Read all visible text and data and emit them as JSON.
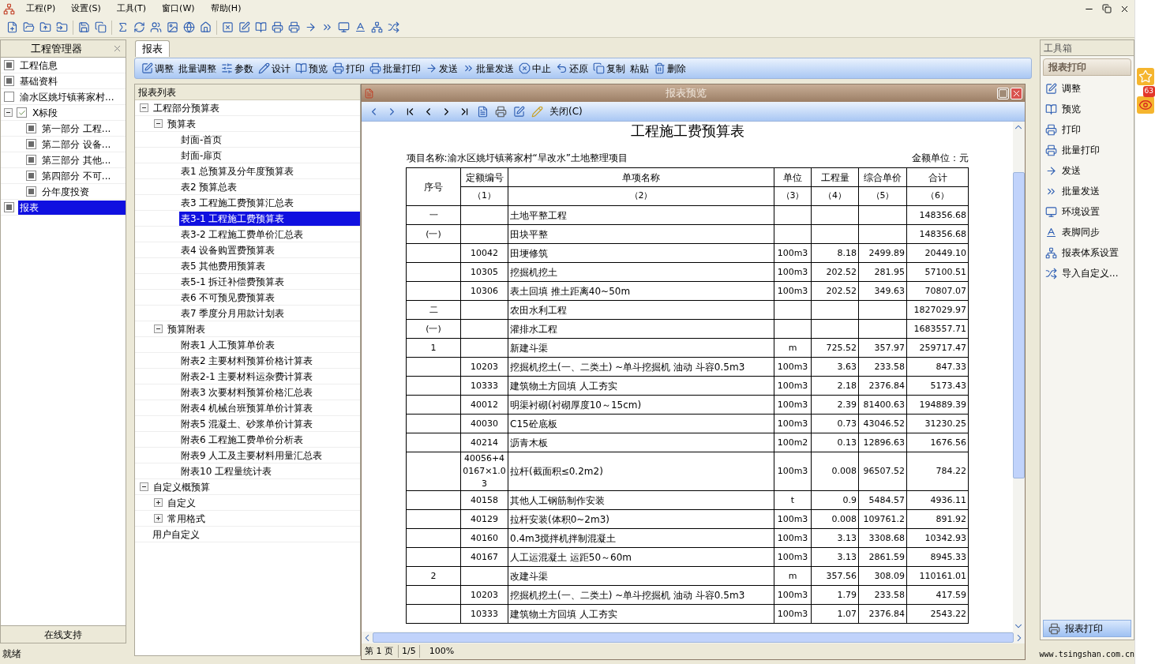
{
  "menu": [
    "工程(P)",
    "设置(S)",
    "工具(T)",
    "窗口(W)",
    "帮助(H)"
  ],
  "project_manager": {
    "title": "工程管理器",
    "items": [
      {
        "label": "工程信息",
        "checked": false,
        "indeterminate": true,
        "selected": false
      },
      {
        "label": "基础资料",
        "checked": false,
        "indeterminate": true,
        "selected": false
      },
      {
        "label": "渝水区姚圩镇蒋家村...",
        "checked": false,
        "indeterminate": false,
        "selected": false
      },
      {
        "label": "X标段",
        "checked": true,
        "indeterminate": false,
        "selected": false,
        "expanded": true,
        "children": [
          {
            "label": "第一部分 工程...",
            "checked": false,
            "indeterminate": true,
            "selected": false
          },
          {
            "label": "第二部分 设备...",
            "checked": false,
            "indeterminate": true,
            "selected": false
          },
          {
            "label": "第三部分 其他...",
            "checked": false,
            "indeterminate": true,
            "selected": false
          },
          {
            "label": "第四部分 不可...",
            "checked": false,
            "indeterminate": true,
            "selected": false
          },
          {
            "label": "分年度投资",
            "checked": false,
            "indeterminate": true,
            "selected": false
          }
        ]
      },
      {
        "label": "报表",
        "checked": false,
        "indeterminate": true,
        "selected": true
      }
    ],
    "footer": "在线支持"
  },
  "tabs": [
    {
      "label": "报表",
      "selected": true
    }
  ],
  "report_toolbar": [
    "调整",
    "批量调整",
    "参数",
    "设计",
    "预览",
    "打印",
    "批量打印",
    "发送",
    "批量发送",
    "中止",
    "还原",
    "复制",
    "粘贴",
    "删除"
  ],
  "report_list": {
    "title": "报表列表",
    "items": [
      {
        "label": "工程部分预算表",
        "selected": false,
        "expanded": true,
        "children": [
          {
            "label": "预算表",
            "selected": false,
            "expanded": true,
            "children": [
              {
                "label": "封面-首页",
                "selected": false
              },
              {
                "label": "封面-扉页",
                "selected": false
              },
              {
                "label": "表1 总预算及分年度预算表",
                "selected": false
              },
              {
                "label": "表2 预算总表",
                "selected": false
              },
              {
                "label": "表3 工程施工费预算汇总表",
                "selected": false
              },
              {
                "label": "表3-1 工程施工费预算表",
                "selected": true
              },
              {
                "label": "表3-2 工程施工费单价汇总表",
                "selected": false
              },
              {
                "label": "表4 设备购置费预算表",
                "selected": false
              },
              {
                "label": "表5 其他费用预算表",
                "selected": false
              },
              {
                "label": "表5-1 拆迁补偿费预算表",
                "selected": false
              },
              {
                "label": "表6 不可预见费预算表",
                "selected": false
              },
              {
                "label": "表7 季度分月用款计划表",
                "selected": false
              }
            ]
          },
          {
            "label": "预算附表",
            "selected": false,
            "expanded": true,
            "children": [
              {
                "label": "附表1 人工预算单价表",
                "selected": false
              },
              {
                "label": "附表2 主要材料预算价格计算表",
                "selected": false
              },
              {
                "label": "附表2-1 主要材料运杂费计算表",
                "selected": false
              },
              {
                "label": "附表3 次要材料预算价格汇总表",
                "selected": false
              },
              {
                "label": "附表4 机械台班预算单价计算表",
                "selected": false
              },
              {
                "label": "附表5 混凝土、砂浆单价计算表",
                "selected": false
              },
              {
                "label": "附表6 工程施工费单价分析表",
                "selected": false
              },
              {
                "label": "附表9 人工及主要材料用量汇总表",
                "selected": false
              },
              {
                "label": "附表10 工程量统计表",
                "selected": false
              }
            ]
          }
        ]
      },
      {
        "label": "自定义概预算",
        "selected": false,
        "expanded": true,
        "children": [
          {
            "label": "自定义",
            "selected": false,
            "expanded": false
          },
          {
            "label": "常用格式",
            "selected": false,
            "expanded": false
          }
        ]
      },
      {
        "label": "用户自定义",
        "selected": false
      }
    ]
  },
  "preview": {
    "title": "报表预览",
    "close_label": "关闭(C)",
    "report": {
      "title": "工程施工费预算表",
      "project": "项目名称:渝水区姚圩镇蒋家村“旱改水”土地整理项目",
      "unit_note": "金额单位：元",
      "columns": [
        {
          "label": "序号"
        },
        {
          "label": "定额编号",
          "index": "（1）"
        },
        {
          "label": "单项名称",
          "index": "（2）"
        },
        {
          "label": "单位",
          "index": "（3）"
        },
        {
          "label": "工程量",
          "index": "（4）"
        },
        {
          "label": "综合单价",
          "index": "（5）"
        },
        {
          "label": "合计",
          "index": "（6）"
        }
      ],
      "rows": [
        {
          "seq": "一",
          "name": "土地平整工程",
          "total": "148356.68"
        },
        {
          "seq": "(一)",
          "name": "田块平整",
          "total": "148356.68"
        },
        {
          "code": "10042",
          "name": "田埂修筑",
          "unit": "100m3",
          "qty": "8.18",
          "price": "2499.89",
          "total": "20449.10"
        },
        {
          "code": "10305",
          "name": "挖掘机挖土",
          "unit": "100m3",
          "qty": "202.52",
          "price": "281.95",
          "total": "57100.51"
        },
        {
          "code": "10306",
          "name": "表土回填  推土距离40~50m",
          "unit": "100m3",
          "qty": "202.52",
          "price": "349.63",
          "total": "70807.07"
        },
        {
          "seq": "二",
          "name": "农田水利工程",
          "total": "1827029.97"
        },
        {
          "seq": "(一)",
          "name": "灌排水工程",
          "total": "1683557.71"
        },
        {
          "seq": "1",
          "name": "新建斗渠",
          "unit": "m",
          "qty": "725.52",
          "price": "357.97",
          "total": "259717.47"
        },
        {
          "code": "10203",
          "name": "挖掘机挖土(一、二类土) ~单斗挖掘机  油动  斗容0.5m3",
          "unit": "100m3",
          "qty": "3.63",
          "price": "233.58",
          "total": "847.33"
        },
        {
          "code": "10333",
          "name": "建筑物土方回填 人工夯实",
          "unit": "100m3",
          "qty": "2.18",
          "price": "2376.84",
          "total": "5173.43"
        },
        {
          "code": "40012",
          "name": "明渠衬砌(衬砌厚度10～15cm)",
          "unit": "100m3",
          "qty": "2.39",
          "price": "81400.63",
          "total": "194889.39"
        },
        {
          "code": "40030",
          "name": "C15砼底板",
          "unit": "100m3",
          "qty": "0.73",
          "price": "43046.52",
          "total": "31230.25"
        },
        {
          "code": "40214",
          "name": "沥青木板",
          "unit": "100m2",
          "qty": "0.13",
          "price": "12896.63",
          "total": "1676.56"
        },
        {
          "code": "40056+40167×1.03",
          "name": "拉杆(截面积≤0.2m2)",
          "unit": "100m3",
          "qty": "0.008",
          "price": "96507.52",
          "total": "784.22"
        },
        {
          "code": "40158",
          "name": "其他人工钢筋制作安装",
          "unit": "t",
          "qty": "0.9",
          "price": "5484.57",
          "total": "4936.11"
        },
        {
          "code": "40129",
          "name": "拉杆安装(体积0~2m3)",
          "unit": "100m3",
          "qty": "0.008",
          "price": "109761.2",
          "total": "891.92"
        },
        {
          "code": "40160",
          "name": "0.4m3搅拌机拌制混凝土",
          "unit": "100m3",
          "qty": "3.13",
          "price": "3308.68",
          "total": "10342.93"
        },
        {
          "code": "40167",
          "name": "人工运混凝土  运距50～60m",
          "unit": "100m3",
          "qty": "3.13",
          "price": "2861.59",
          "total": "8945.33"
        },
        {
          "seq": "2",
          "name": "改建斗渠",
          "unit": "m",
          "qty": "357.56",
          "price": "308.09",
          "total": "110161.01"
        },
        {
          "code": "10203",
          "name": "挖掘机挖土(一、二类土) ~单斗挖掘机  油动  斗容0.5m3",
          "unit": "100m3",
          "qty": "1.79",
          "price": "233.58",
          "total": "417.59"
        },
        {
          "code": "10333",
          "name": "建筑物土方回填 人工夯实",
          "unit": "100m3",
          "qty": "1.07",
          "price": "2376.84",
          "total": "2543.22"
        }
      ]
    },
    "page": "第 1 页",
    "page_count": "1/5",
    "zoom": "100%"
  },
  "toolbox": {
    "title": "工具箱",
    "section": "报表打印",
    "items": [
      "调整",
      "预览",
      "打印",
      "批量打印",
      "发送",
      "批量发送",
      "环境设置",
      "表脚同步",
      "报表体系设置",
      "导入自定义..."
    ],
    "footer": "报表打印"
  },
  "status_bar": {
    "text": "就绪",
    "website": "www.tsingshan.com.cn"
  },
  "browser_sidebar": {
    "badge": "63"
  }
}
